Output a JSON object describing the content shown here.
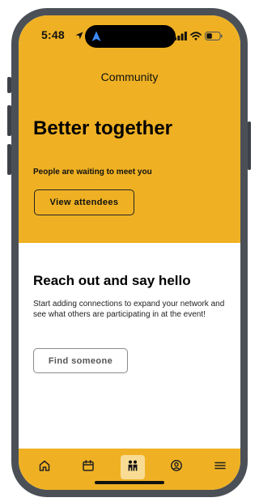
{
  "status_bar": {
    "time": "5:48",
    "icons": [
      "location-arrow-icon",
      "navigation-icon",
      "cellular-signal-icon",
      "wifi-icon",
      "battery-icon"
    ]
  },
  "header": {
    "title": "Community"
  },
  "hero": {
    "title": "Better together",
    "subtitle": "People are waiting to meet you",
    "button_label": "View attendees"
  },
  "section": {
    "title": "Reach out and say hello",
    "body": "Start adding connections to expand your network and see what others are participating in at the event!",
    "button_label": "Find someone"
  },
  "tab_bar": {
    "tabs": [
      {
        "icon": "home-icon",
        "active": false
      },
      {
        "icon": "calendar-icon",
        "active": false
      },
      {
        "icon": "people-icon",
        "active": true
      },
      {
        "icon": "profile-icon",
        "active": false
      },
      {
        "icon": "menu-icon",
        "active": false
      }
    ]
  },
  "colors": {
    "brand_yellow": "#efb123",
    "active_tab": "#f8dc94",
    "frame": "#4b5057",
    "text": "#000000"
  }
}
